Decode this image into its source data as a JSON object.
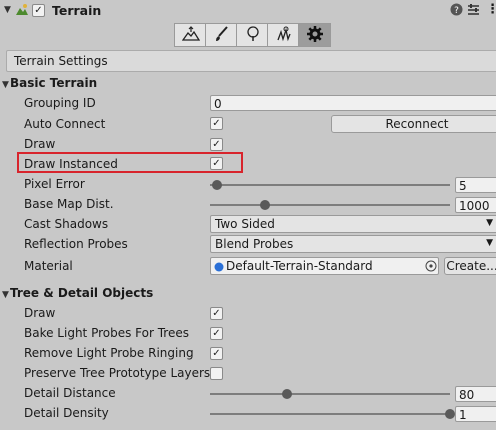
{
  "component": {
    "title": "Terrain",
    "enabled": true,
    "icons": {
      "component": "terrain-icon",
      "help": "help-icon",
      "presets": "presets-icon",
      "menu": "kebab-icon"
    }
  },
  "toolbar": {
    "tools": [
      {
        "name": "raise-lower-terrain-icon",
        "selected": false
      },
      {
        "name": "paint-brush-icon",
        "selected": false
      },
      {
        "name": "paint-trees-icon",
        "selected": false
      },
      {
        "name": "paint-details-icon",
        "selected": false
      },
      {
        "name": "settings-gear-icon",
        "selected": true
      }
    ]
  },
  "settings_bar": {
    "label": "Terrain Settings"
  },
  "basic": {
    "header": "Basic Terrain",
    "grouping_id": {
      "label": "Grouping ID",
      "value": "0"
    },
    "auto_connect": {
      "label": "Auto Connect",
      "checked": true
    },
    "reconnect": {
      "label": "Reconnect"
    },
    "draw": {
      "label": "Draw",
      "checked": true
    },
    "draw_instanced": {
      "label": "Draw Instanced",
      "checked": true
    },
    "pixel_error": {
      "label": "Pixel Error",
      "value": "5",
      "fraction": 0.03
    },
    "base_map_dist": {
      "label": "Base Map Dist.",
      "value": "1000",
      "fraction": 0.23
    },
    "cast_shadows": {
      "label": "Cast Shadows",
      "value": "Two Sided"
    },
    "reflection_probes": {
      "label": "Reflection Probes",
      "value": "Blend Probes"
    },
    "material": {
      "label": "Material",
      "value": "Default-Terrain-Standard",
      "create": "Create..."
    }
  },
  "tree": {
    "header": "Tree & Detail Objects",
    "draw": {
      "label": "Draw",
      "checked": true
    },
    "bake_light_probes": {
      "label": "Bake Light Probes For Trees",
      "checked": true
    },
    "remove_ringing": {
      "label": "Remove Light Probe Ringing",
      "checked": true
    },
    "preserve_layers": {
      "label": "Preserve Tree Prototype Layers",
      "checked": false
    },
    "detail_distance": {
      "label": "Detail Distance",
      "value": "80",
      "fraction": 0.32
    },
    "detail_density": {
      "label": "Detail Density",
      "value": "1",
      "fraction": 1.0
    }
  },
  "check_glyph": "✓"
}
